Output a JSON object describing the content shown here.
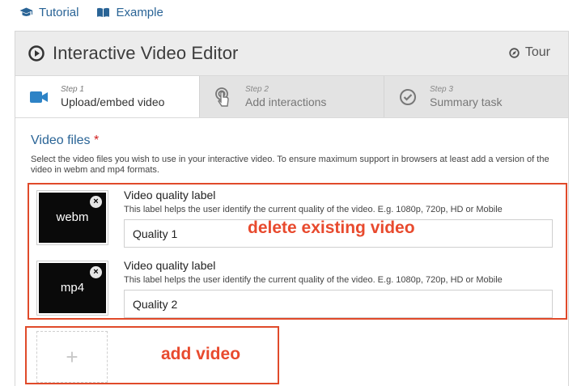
{
  "toplinks": [
    {
      "label": "Tutorial",
      "icon": "graduation-cap-icon"
    },
    {
      "label": "Example",
      "icon": "open-book-icon"
    }
  ],
  "header": {
    "title": "Interactive Video Editor",
    "tour_label": "Tour"
  },
  "steps": [
    {
      "step": "Step 1",
      "label": "Upload/embed video",
      "active": true,
      "icon": "video-camera-icon"
    },
    {
      "step": "Step 2",
      "label": "Add interactions",
      "active": false,
      "icon": "touch-icon"
    },
    {
      "step": "Step 3",
      "label": "Summary task",
      "active": false,
      "icon": "check-circle-icon"
    }
  ],
  "video_files": {
    "title": "Video files",
    "required_mark": "*",
    "description": "Select the video files you wish to use in your interactive video. To ensure maximum support in browsers at least add a version of the video in webm and mp4 formats.",
    "items": [
      {
        "format": "webm",
        "close": "×",
        "field_label": "Video quality label",
        "field_desc": "This label helps the user identify the current quality of the video. E.g. 1080p, 720p, HD or Mobile",
        "value": "Quality 1"
      },
      {
        "format": "mp4",
        "close": "×",
        "field_label": "Video quality label",
        "field_desc": "This label helps the user identify the current quality of the video. E.g. 1080p, 720p, HD or Mobile",
        "value": "Quality 2"
      }
    ],
    "add_symbol": "+"
  },
  "annotations": {
    "delete": "delete existing video",
    "add": "add video"
  },
  "colors": {
    "link": "#2a6496",
    "annotation": "#e84a2e",
    "active_icon": "#2d83c6"
  }
}
